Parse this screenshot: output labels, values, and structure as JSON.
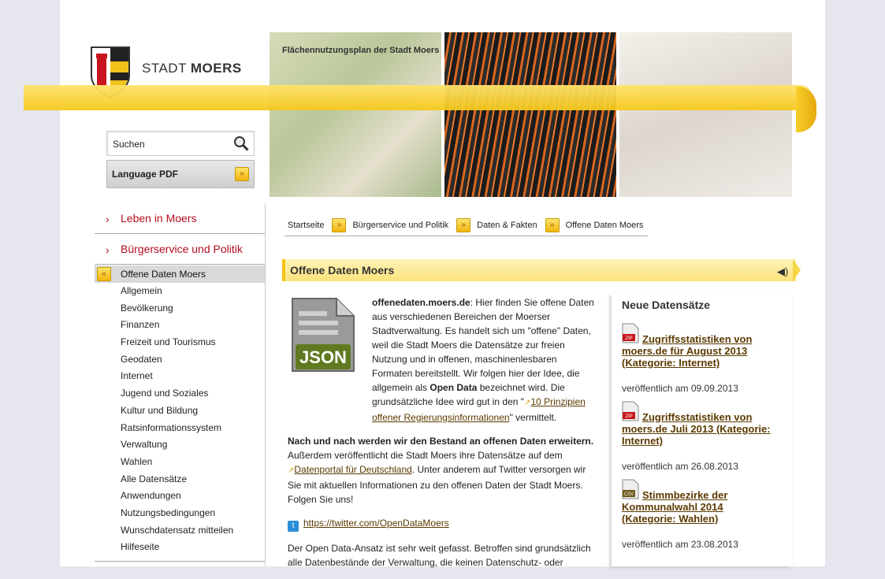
{
  "brand": {
    "prefix": "STADT",
    "name": "MOERS"
  },
  "hero": {
    "caption": "Flächennutzungsplan der Stadt Moers"
  },
  "search": {
    "label": "Suchen"
  },
  "language": {
    "label": "Language PDF"
  },
  "nav": {
    "sections": [
      {
        "label": "Leben in Moers"
      },
      {
        "label": "Bürgerservice und Politik"
      }
    ],
    "active": "Offene Daten Moers",
    "items": [
      "Allgemein",
      "Bevölkerung",
      "Finanzen",
      "Freizeit und Tourismus",
      "Geodaten",
      "Internet",
      "Jugend und Soziales",
      "Kultur und Bildung",
      "Ratsinformationssystem",
      "Verwaltung",
      "Wahlen",
      "Alle Datensätze",
      "Anwendungen",
      "Nutzungsbedingungen",
      "Wunschdatensatz mitteilen",
      "Hilfeseite"
    ]
  },
  "breadcrumb": [
    "Startseite",
    "Bürgerservice und Politik",
    "Daten & Fakten",
    "Offene Daten Moers"
  ],
  "heading": "Offene Daten Moers",
  "content": {
    "p1_bold": "offenedaten.moers.de",
    "p1_text": ": Hier finden Sie offene Daten aus verschiedenen Bereichen der Moerser Stadtverwaltung. Es handelt sich um \"offene\" Daten, weil die Stadt Moers die Datensätze zur freien Nutzung und in offenen, maschinenlesbaren Formaten bereitstellt. Wir folgen hier der Idee, die allgemein als ",
    "p1_bold2": "Open Data",
    "p1_text2": " bezeichnet wird. Die grundsätzliche Idee wird gut in den \"",
    "p1_link": "10 Prinzipien offener Regierungsinformationen",
    "p1_text3": "\" vermittelt.",
    "p2_bold": "Nach und nach werden wir den Bestand an offenen Daten erweitern.",
    "p2_text": " Außerdem veröffentlicht die Stadt Moers ihre Datensätze auf dem ",
    "p2_link": "Datenportal für Deutschland",
    "p2_text2": ". Unter anderem auf Twitter versorgen wir Sie mit aktuellen Informationen zu den offenen Daten der Stadt Moers. Folgen Sie uns!",
    "twitter_link": "https://twitter.com/OpenDataMoers",
    "p3_text": "Der Open Data-Ansatz ist sehr weit gefasst. Betroffen sind grundsätzlich alle Datenbestände der Verwaltung, die keinen Datenschutz- oder",
    "json_label": "JSON"
  },
  "sidebar": {
    "title": "Neue Datensätze",
    "datasets": [
      {
        "format": "ZIP",
        "title": "Zugriffsstatistiken von moers.de für August 2013 (Kategorie: Internet)",
        "published": "veröffentlich am 09.09.2013"
      },
      {
        "format": "ZIP",
        "title": "Zugriffsstatistiken von moers.de Juli 2013 (Kategorie: Internet)",
        "published": "veröffentlich am 26.08.2013"
      },
      {
        "format": "CSV",
        "title": "Stimmbezirke der Kommunalwahl 2014 (Kategorie: Wahlen)",
        "published": "veröffentlich am 23.08.2013"
      }
    ]
  }
}
